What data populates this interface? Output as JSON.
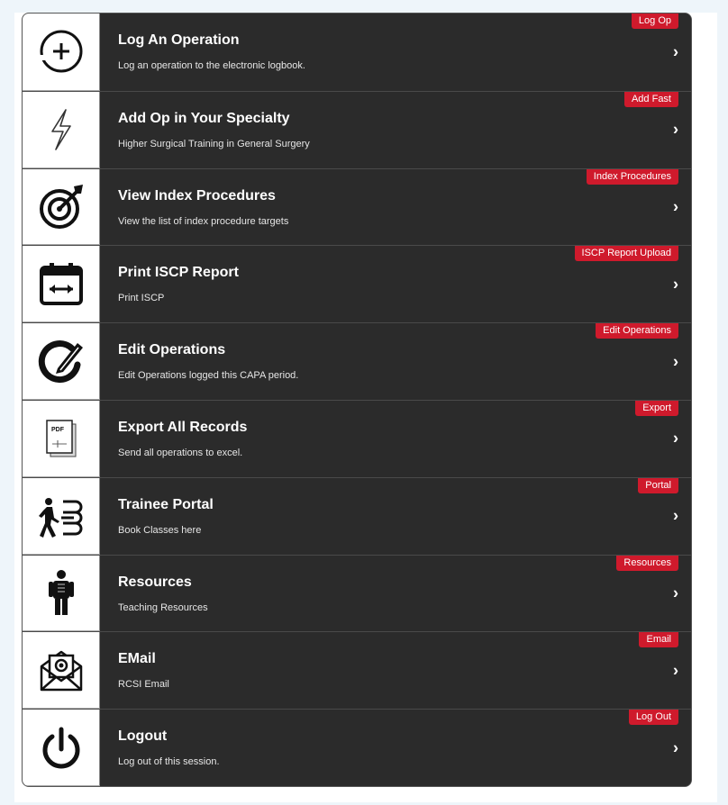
{
  "menu": {
    "items": [
      {
        "title": "Log An Operation",
        "subtitle": "Log an operation to the electronic logbook.",
        "badge": "Log Op",
        "icon": "plus-circle-icon"
      },
      {
        "title": "Add Op in Your Specialty",
        "subtitle": "Higher Surgical Training in General Surgery",
        "badge": "Add Fast",
        "icon": "lightning-icon"
      },
      {
        "title": "View Index Procedures",
        "subtitle": "View the list of index procedure targets",
        "badge": "Index Procedures",
        "icon": "target-icon"
      },
      {
        "title": "Print ISCP Report",
        "subtitle": "Print ISCP",
        "badge": "ISCP Report Upload",
        "icon": "calendar-icon"
      },
      {
        "title": "Edit Operations",
        "subtitle": "Edit Operations logged this CAPA period.",
        "badge": "Edit Operations",
        "icon": "edit-icon"
      },
      {
        "title": "Export All Records",
        "subtitle": "Send all operations to excel.",
        "badge": "Export",
        "icon": "pdf-icon"
      },
      {
        "title": "Trainee Portal",
        "subtitle": "Book Classes here",
        "badge": "Portal",
        "icon": "portal-icon"
      },
      {
        "title": "Resources",
        "subtitle": "Teaching Resources",
        "badge": "Resources",
        "icon": "anatomy-icon"
      },
      {
        "title": "EMail",
        "subtitle": "RCSI Email",
        "badge": "Email",
        "icon": "email-icon"
      },
      {
        "title": "Logout",
        "subtitle": "Log out of this session.",
        "badge": "Log Out",
        "icon": "power-icon"
      }
    ],
    "chevron": "›",
    "pdf_label": "PDF"
  },
  "colors": {
    "badge": "#cf1a2c",
    "row_bg": "#2b2b2b",
    "page_bg": "#eef5fa"
  }
}
